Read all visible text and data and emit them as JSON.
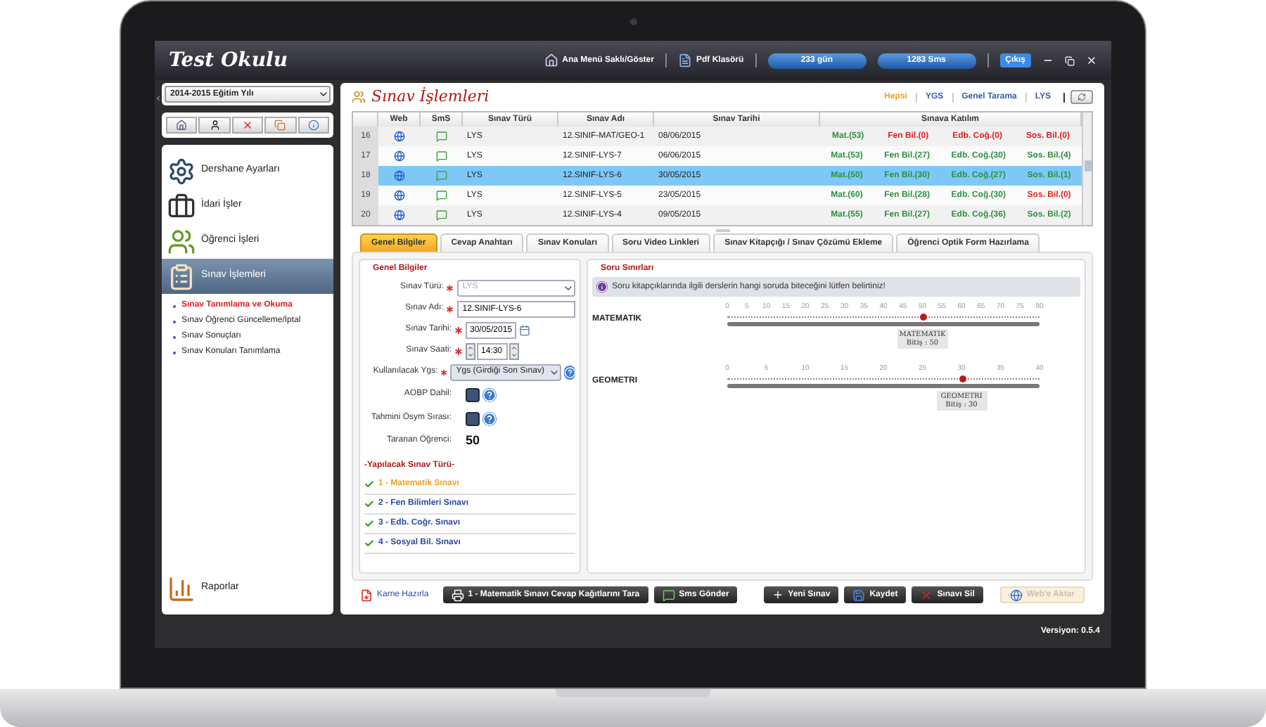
{
  "window": {
    "title": "Test Okulu",
    "menu_toggle": "Ana Menü Saklı/Göster",
    "pdf_folder": "Pdf Klasörü",
    "days": "233 gün",
    "sms": "1283 Sms",
    "logout": "Çıkış"
  },
  "sidebar": {
    "year": "2014-2015 Eğitim Yılı",
    "items": [
      {
        "label": "Dershane Ayarları",
        "kind": "settings",
        "selected": false
      },
      {
        "label": "İdari İşler",
        "kind": "admin",
        "selected": false
      },
      {
        "label": "Öğrenci İşleri",
        "kind": "students",
        "selected": false
      },
      {
        "label": "Sınav İşlemleri",
        "kind": "exam",
        "selected": true,
        "children": [
          {
            "label": "Sınav Tanımlama ve Okuma",
            "selected": true
          },
          {
            "label": "Sınav Öğrenci Güncelleme/İptal",
            "selected": false
          },
          {
            "label": "Sınav Sonuçları",
            "selected": false
          },
          {
            "label": "Sınav Konuları Tanımlama",
            "selected": false
          }
        ]
      }
    ],
    "bottom_item": {
      "label": "Raporlar",
      "kind": "reports"
    }
  },
  "main": {
    "title": "Sınav İşlemleri",
    "filters": [
      {
        "label": "Hepsi",
        "selected": true
      },
      {
        "label": "YGS",
        "selected": false
      },
      {
        "label": "Genel Tarama",
        "selected": false
      },
      {
        "label": "LYS",
        "selected": false
      }
    ],
    "table": {
      "columns": [
        "Web",
        "SmS",
        "Sınav Türü",
        "Sınav Adı",
        "Sınav Tarihi",
        "Sınava Katılım"
      ],
      "rows": [
        {
          "number": "16",
          "type": "LYS",
          "name": "12.SINIF-MAT/GEO-1",
          "date": "08/06/2015",
          "selected": false,
          "participation": [
            {
              "text": "Mat.(53)",
              "color": "#2f8f3f"
            },
            {
              "text": "Fen Bil.(0)",
              "color": "#e02020"
            },
            {
              "text": "Edb. Coğ.(0)",
              "color": "#e02020"
            },
            {
              "text": "Sos. Bil.(0)",
              "color": "#e02020"
            }
          ]
        },
        {
          "number": "17",
          "type": "LYS",
          "name": "12.SINIF-LYS-7",
          "date": "06/06/2015",
          "selected": false,
          "participation": [
            {
              "text": "Mat.(53)",
              "color": "#2f8f3f"
            },
            {
              "text": "Fen Bil.(27)",
              "color": "#2f8f3f"
            },
            {
              "text": "Edb. Coğ.(30)",
              "color": "#2f8f3f"
            },
            {
              "text": "Sos. Bil.(4)",
              "color": "#2f8f3f"
            }
          ]
        },
        {
          "number": "18",
          "type": "LYS",
          "name": "12.SINIF-LYS-6",
          "date": "30/05/2015",
          "selected": true,
          "participation": [
            {
              "text": "Mat.(50)",
              "color": "#2f8f3f"
            },
            {
              "text": "Fen Bil.(30)",
              "color": "#2f8f3f"
            },
            {
              "text": "Edb. Coğ.(27)",
              "color": "#2f8f3f"
            },
            {
              "text": "Sos. Bil.(1)",
              "color": "#2f8f3f"
            }
          ]
        },
        {
          "number": "19",
          "type": "LYS",
          "name": "12.SINIF-LYS-5",
          "date": "23/05/2015",
          "selected": false,
          "participation": [
            {
              "text": "Mat.(60)",
              "color": "#2f8f3f"
            },
            {
              "text": "Fen Bil.(28)",
              "color": "#2f8f3f"
            },
            {
              "text": "Edb. Coğ.(30)",
              "color": "#2f8f3f"
            },
            {
              "text": "Sos. Bil.(0)",
              "color": "#e02020"
            }
          ]
        },
        {
          "number": "20",
          "type": "LYS",
          "name": "12.SINIF-LYS-4",
          "date": "09/05/2015",
          "selected": false,
          "participation": [
            {
              "text": "Mat.(55)",
              "color": "#2f8f3f"
            },
            {
              "text": "Fen Bil.(27)",
              "color": "#2f8f3f"
            },
            {
              "text": "Edb. Coğ.(36)",
              "color": "#2f8f3f"
            },
            {
              "text": "Sos. Bil.(2)",
              "color": "#2f8f3f"
            }
          ]
        }
      ]
    },
    "tabs": [
      {
        "label": "Genel Bilgiler",
        "selected": true
      },
      {
        "label": "Cevap Anahtarı",
        "selected": false
      },
      {
        "label": "Sınav Konuları",
        "selected": false
      },
      {
        "label": "Soru Video Linkleri",
        "selected": false
      },
      {
        "label": "Sınav Kitapçığı / Sınav Çözümü Ekleme",
        "selected": false
      },
      {
        "label": "Öğrenci Optik Form Hazırlama",
        "selected": false
      }
    ],
    "general": {
      "legend": "Genel Bilgiler",
      "fields": [
        {
          "kind": "select",
          "label": "Sınav Türü:",
          "value": "LYS",
          "required": true,
          "disabled": true,
          "help": false
        },
        {
          "kind": "text",
          "label": "Sınav Adı:",
          "value": "12.SINIF-LYS-6",
          "required": true,
          "help": false
        },
        {
          "kind": "date",
          "label": "Sınav Tarihi:",
          "value": "30/05/2015",
          "required": true,
          "help": false
        },
        {
          "kind": "time",
          "label": "Sınav Saati:",
          "value": "14:30",
          "required": true,
          "help": false
        },
        {
          "kind": "select",
          "label": "Kullanılacak Ygs:",
          "value": "Ygs (Girdiği Son Sınav)",
          "required": true,
          "disabled": false,
          "help": true
        },
        {
          "kind": "checkbox",
          "label": "AOBP Dahil:",
          "checked": false,
          "required": false,
          "help": true
        },
        {
          "kind": "checkbox",
          "label": "Tahmini Ösym Sırası:",
          "checked": false,
          "required": false,
          "help": true
        },
        {
          "kind": "count",
          "label": "Taranan Öğrenci:",
          "value": "50",
          "required": false,
          "help": false
        }
      ],
      "exam_types": {
        "title": "-Yapılacak Sınav Türü-",
        "items": [
          {
            "label": "1 - Matematik Sınavı",
            "selected": true
          },
          {
            "label": "2 - Fen Bilimleri Sınavı",
            "selected": false
          },
          {
            "label": "3 - Edb. Coğr. Sınavı",
            "selected": false
          },
          {
            "label": "4 - Sosyal Bil. Sınavı",
            "selected": false
          }
        ]
      }
    },
    "limits": {
      "legend": "Soru Sınırları",
      "info": "Soru kitapçıklarında ilgili derslerin hangi soruda biteceğini lütfen belirtiniz!",
      "sliders": [
        {
          "label": "MATEMATIK",
          "ticks": [
            "0",
            "5",
            "10",
            "15",
            "20",
            "25",
            "30",
            "35",
            "40",
            "45",
            "50",
            "55",
            "60",
            "65",
            "70",
            "75",
            "80"
          ],
          "level": 0.625,
          "tooltip_title": "MATEMATIK",
          "tooltip_value": "Bitiş : 50"
        },
        {
          "label": "GEOMETRI",
          "ticks": [
            "0",
            "5",
            "10",
            "15",
            "20",
            "25",
            "30",
            "35",
            "40"
          ],
          "level": 0.75,
          "tooltip_title": "GEOMETRI",
          "tooltip_value": "Bitiş : 30"
        }
      ]
    },
    "footer": [
      {
        "label": "Karne Hazırla",
        "kind": "link"
      },
      {
        "label": "1 - Matematik Sınavı Cevap Kağıtlarını Tara",
        "kind": "scan"
      },
      {
        "label": "Sms Gönder",
        "kind": "sms"
      },
      {
        "label": "Yeni Sınav",
        "kind": "new"
      },
      {
        "label": "Kaydet",
        "kind": "save"
      },
      {
        "label": "Sınavı Sil",
        "kind": "delete"
      },
      {
        "label": "Web'e Aktar",
        "kind": "web"
      }
    ]
  },
  "version": "Versiyon: 0.5.4"
}
